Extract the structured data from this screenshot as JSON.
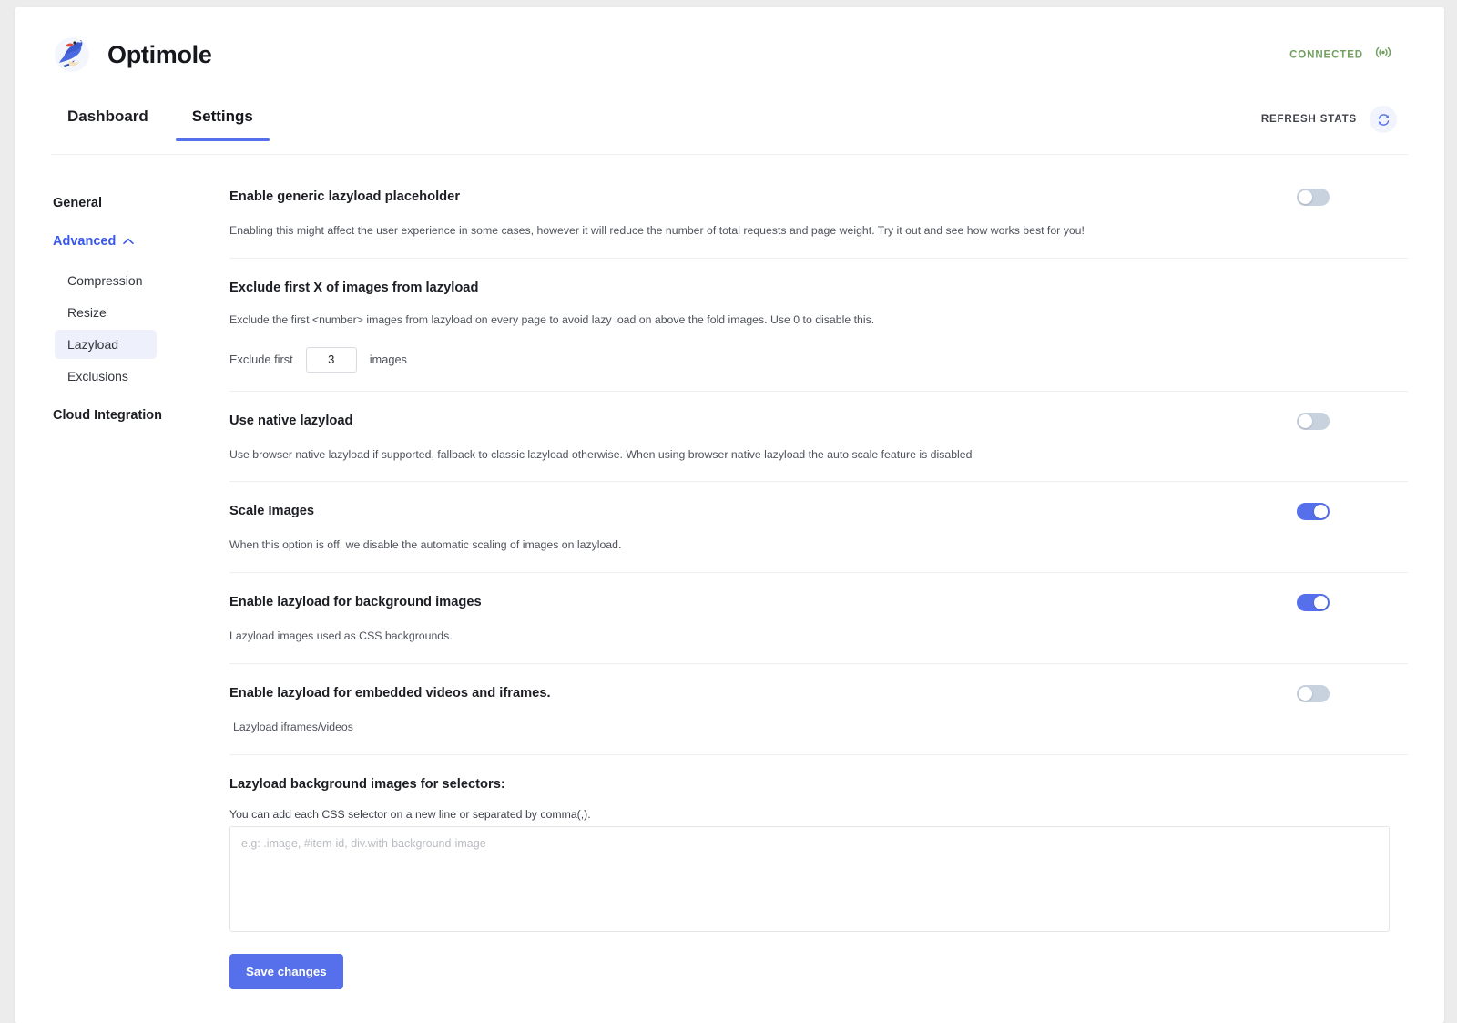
{
  "app": {
    "name": "Optimole",
    "logo_icon": "optimole-bird-logo"
  },
  "header": {
    "connection_status": "CONNECTED",
    "connection_icon": "broadcast-signal-icon"
  },
  "tabs": [
    {
      "label": "Dashboard",
      "active": false
    },
    {
      "label": "Settings",
      "active": true
    }
  ],
  "toolbar": {
    "refresh_label": "REFRESH STATS",
    "refresh_icon": "refresh-circular-arrow-icon"
  },
  "sidebar": {
    "items": [
      {
        "label": "General",
        "type": "top",
        "active": false
      },
      {
        "label": "Advanced",
        "type": "top",
        "active": true,
        "icon": "chevron-up-icon"
      },
      {
        "label": "Compression",
        "type": "sub",
        "selected": false
      },
      {
        "label": "Resize",
        "type": "sub",
        "selected": false
      },
      {
        "label": "Lazyload",
        "type": "sub",
        "selected": true
      },
      {
        "label": "Exclusions",
        "type": "sub",
        "selected": false
      },
      {
        "label": "Cloud Integration",
        "type": "top",
        "active": false
      }
    ]
  },
  "settings": [
    {
      "title": "Enable generic lazyload placeholder",
      "description": "Enabling this might affect the user experience in some cases, however it will reduce the number of total requests and page weight. Try it out and see how works best for you!",
      "toggle": "off"
    },
    {
      "title": "Exclude first X of images from lazyload",
      "description": "Exclude the first <number> images from lazyload on every page to avoid lazy load on above the fold images. Use 0 to disable this.",
      "field_prefix": "Exclude first",
      "field_value": "3",
      "field_suffix": "images"
    },
    {
      "title": "Use native lazyload",
      "description": "Use browser native lazyload if supported, fallback to classic lazyload otherwise. When using browser native lazyload the auto scale feature is disabled",
      "toggle": "off"
    },
    {
      "title": "Scale Images",
      "description": "When this option is off, we disable the automatic scaling of images on lazyload.",
      "toggle": "on"
    },
    {
      "title": "Enable lazyload for background images",
      "description": "Lazyload images used as CSS backgrounds.",
      "toggle": "on"
    },
    {
      "title": "Enable lazyload for embedded videos and iframes.",
      "description": "Lazyload iframes/videos",
      "toggle": "off"
    }
  ],
  "selectors_block": {
    "title": "Lazyload background images for selectors:",
    "description": "You can add each CSS selector on a new line or separated by comma(,).",
    "textarea_value": "",
    "textarea_placeholder": "e.g: .image, #item-id, div.with-background-image"
  },
  "actions": {
    "save_label": "Save changes"
  },
  "colors": {
    "accent_blue": "#5570ea",
    "nav_blue": "#3858e9",
    "connected_green": "#71a05f",
    "toggle_off": "#c8d1de",
    "page_bg": "#ececec"
  }
}
